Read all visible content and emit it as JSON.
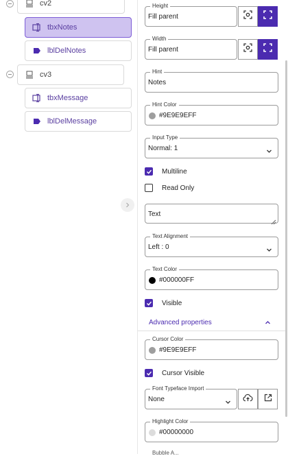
{
  "tree": {
    "nodes": [
      {
        "id": "cv2",
        "label": "cv2",
        "kind": "container"
      },
      {
        "id": "tbxNotes",
        "label": "tbxNotes",
        "kind": "textbox",
        "selected": true
      },
      {
        "id": "lblDelNotes",
        "label": "lblDelNotes",
        "kind": "label"
      },
      {
        "id": "cv3",
        "label": "cv3",
        "kind": "container"
      },
      {
        "id": "tbxMessage",
        "label": "tbxMessage",
        "kind": "textbox"
      },
      {
        "id": "lblDelMessage",
        "label": "lblDelMessage",
        "kind": "label"
      }
    ]
  },
  "props": {
    "height": {
      "label": "Height",
      "value": "Fill parent"
    },
    "width": {
      "label": "Width",
      "value": "Fill parent"
    },
    "hint": {
      "label": "Hint",
      "value": "Notes"
    },
    "hint_color": {
      "label": "Hint Color",
      "value": "#9E9E9EFF",
      "swatch": "#9e9e9e"
    },
    "input_type": {
      "label": "Input Type",
      "value": "Normal: 1"
    },
    "multiline": {
      "label": "Multiline",
      "checked": true
    },
    "read_only": {
      "label": "Read Only",
      "checked": false
    },
    "text": {
      "value": "Text"
    },
    "text_alignment": {
      "label": "Text Alignment",
      "value": "Left : 0"
    },
    "text_color": {
      "label": "Text Color",
      "value": "#000000FF",
      "swatch": "#000000"
    },
    "visible": {
      "label": "Visible",
      "checked": true
    }
  },
  "advanced": {
    "title": "Advanced properties",
    "cursor_color": {
      "label": "Cursor Color",
      "value": "#9E9E9EFF",
      "swatch": "#9e9e9e"
    },
    "cursor_visible": {
      "label": "Cursor Visible",
      "checked": true
    },
    "font_typeface": {
      "label": "Font Typeface Import",
      "value": "None"
    },
    "highlight_color": {
      "label": "Highlight Color",
      "value": "#00000000",
      "swatch": "#dcdcdc"
    },
    "cutoff_label": "Bubble A..."
  },
  "colors": {
    "accent": "#4b2bb0",
    "selected_bg": "#cfc3f0"
  }
}
